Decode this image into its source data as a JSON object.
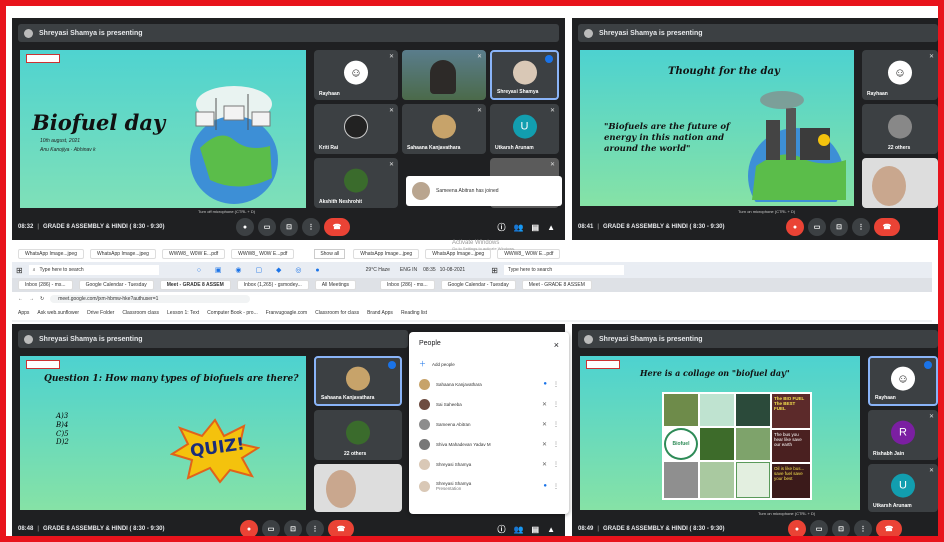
{
  "windows": {
    "tl": {
      "presenting": "Shreyasi Shamya is presenting",
      "slide": {
        "title": "Biofuel day",
        "subtitle": "10th august, 2021",
        "byline": "Anu Kanojiya · Abhinav k"
      },
      "tiles": [
        "Rayhaan",
        "",
        "Shreyasi Shamya",
        "Kriti Rai",
        "Sahaana Kanjavathara",
        "Utkarsh Arunam",
        "Akshith Neshrohit"
      ],
      "utkarsh_initial": "U",
      "toast": "Sameena Abitran has joined",
      "mic_hint": "Turn off microphone (CTRL + D)",
      "clock": "08:32",
      "meeting": "GRADE 8 ASSEMBLY & HINDI ( 8:30 - 9:30)",
      "pause": "II"
    },
    "tr": {
      "presenting": "Shreyasi Shamya is presenting",
      "slide": {
        "title": "Thought for the day",
        "quote": "\"Biofuels are the future of energy in this nation and around the world\""
      },
      "tiles": [
        "Rayhaan",
        "22 others"
      ],
      "mic_hint": "Turn on microphone (CTRL + D)",
      "clock": "08:41",
      "meeting": "GRADE 8 ASSEMBLY & HINDI ( 8:30 - 9:30)"
    },
    "bl": {
      "presenting": "Shreyasi Shamya is presenting",
      "slide": {
        "title": "Question 1: How many types of biofuels are there?",
        "options": [
          "A)3",
          "B)4",
          "C)5",
          "D)2"
        ],
        "quiz": "QUIZ!"
      },
      "tiles": [
        "Sahaana Kanjavathara",
        "22 others"
      ],
      "clock": "08:48",
      "meeting": "GRADE 8 ASSEMBLY & HINDI ( 8:30 - 9:30)"
    },
    "br": {
      "presenting": "Shreyasi Shamya is presenting",
      "slide": {
        "title": "Here is a collage on \"biofuel day\"",
        "cards": [
          "The BIO FUEL The BEST FUEL",
          "The bus you hear like save our earth",
          "Oil is like bus... save fuel save your best"
        ],
        "badge": "Biofuel"
      },
      "tiles": [
        "Rayhaan",
        "Rishabh Jain",
        "Utkarsh Arunam"
      ],
      "rishabh_initial": "R",
      "utkarsh_initial": "U",
      "mic_hint": "Turn on microphone (CTRL + D)",
      "clock": "08:49",
      "meeting": "GRADE 8 ASSEMBLY & HINDI ( 8:30 - 9:30)"
    }
  },
  "browser": {
    "downloads": [
      "WhatsApp Image...jpeg",
      "WhatsApp Image...jpeg",
      "WWW8_ W0W E...pdf",
      "WWW8_ W0W E...pdf",
      "WhatsApp Image...jpeg",
      "WhatsApp Image...jpeg",
      "WWW8_ W0W E...pdf",
      "WWW8_ W0W E...pdf"
    ],
    "show_all": "Show all",
    "activate": "Activate Windows",
    "activate_sub": "Go to Settings to activate Windows.",
    "search_placeholder": "Type here to search",
    "weather": "29°C Haze",
    "lang": "ENG IN",
    "time": "08:35",
    "date": "10-08-2021",
    "tabs": [
      "Inbox (286) - ms...",
      "Google Calendar - Tuesday",
      "Meet - GRADE 8 ASSEM",
      "Inbox (1,265) - gsmodey...",
      "All Meetings",
      "Inbox (286) - ms...",
      "Google Calendar - Tuesday",
      "Meet - GRADE 8 ASSEM",
      "Inbox (1,265) - gsmodey..."
    ],
    "url": "meet.google.com/jxm-hbmw-hke?authuser=1",
    "bookmarks": [
      "Apps",
      "Ask web.sunflower",
      "Drive Folder",
      "Classroom class",
      "Lesson 1: Text",
      "Computer Book - pro...",
      "Franvugoagle.com",
      "Classroom for class",
      "Brand Apps",
      "Reading list"
    ]
  },
  "people": {
    "title": "People",
    "close": "×",
    "add": "Add people",
    "rows": [
      {
        "name": "Sahaana Kanjavathara",
        "note": ""
      },
      {
        "name": "Sai Saheeba",
        "note": ""
      },
      {
        "name": "Sameena Abitran",
        "note": ""
      },
      {
        "name": "Shiva Mahadevan Yadav M",
        "note": ""
      },
      {
        "name": "Shreyasi Shamya",
        "note": ""
      },
      {
        "name": "Shreyasi Shamya",
        "note": "Presentation"
      }
    ]
  },
  "colors": {
    "border": "#e8141c",
    "meetBg": "#1f2022",
    "tile": "#3c4043",
    "red": "#ea4335",
    "blue": "#1a73e8",
    "slide": "#5fd6c4"
  }
}
